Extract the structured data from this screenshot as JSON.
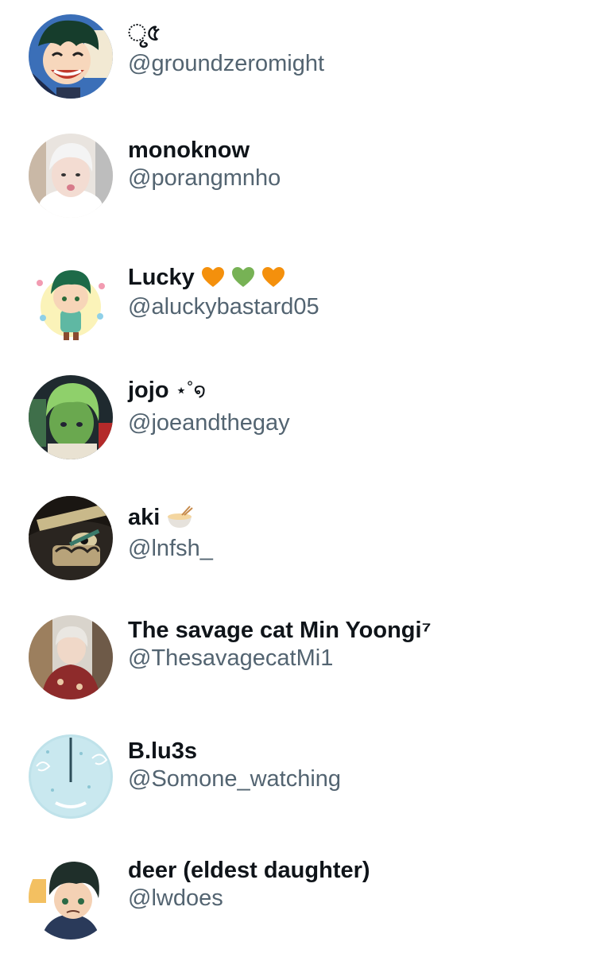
{
  "accounts": [
    {
      "display_name": "ୃ৫",
      "handle": "@groundzeromight",
      "avatar": "avatar-anime-boy-grin"
    },
    {
      "display_name": "monoknow",
      "handle": "@porangmnho",
      "avatar": "avatar-person-white-hair"
    },
    {
      "display_name": "Lucky",
      "handle": "@aluckybastard05",
      "avatar": "avatar-chibi-green-hair",
      "badges": [
        "orange-heart-icon",
        "green-heart-icon",
        "orange-heart-icon"
      ]
    },
    {
      "display_name": "jojo",
      "display_suffix": "⋆˚໑",
      "handle": "@joeandthegay",
      "avatar": "avatar-green-face"
    },
    {
      "display_name": "aki",
      "handle": "@lnfsh_",
      "avatar": "avatar-dark-anime-closeup",
      "badges": [
        "noodle-bowl-icon"
      ]
    },
    {
      "display_name": "The savage cat Min Yoongi⁷",
      "handle": "@ThesavagecatMi1",
      "avatar": "avatar-person-red-outfit"
    },
    {
      "display_name": "B.lu3s",
      "handle": "@Somone_watching",
      "avatar": "avatar-blue-textured"
    },
    {
      "display_name": "deer (eldest daughter)",
      "handle": "@lwdoes",
      "avatar": "avatar-anime-boy-dark-hair"
    }
  ],
  "colors": {
    "name": "#0f1419",
    "handle": "#536471",
    "orange_heart": "#f4900c",
    "green_heart": "#77b255"
  }
}
